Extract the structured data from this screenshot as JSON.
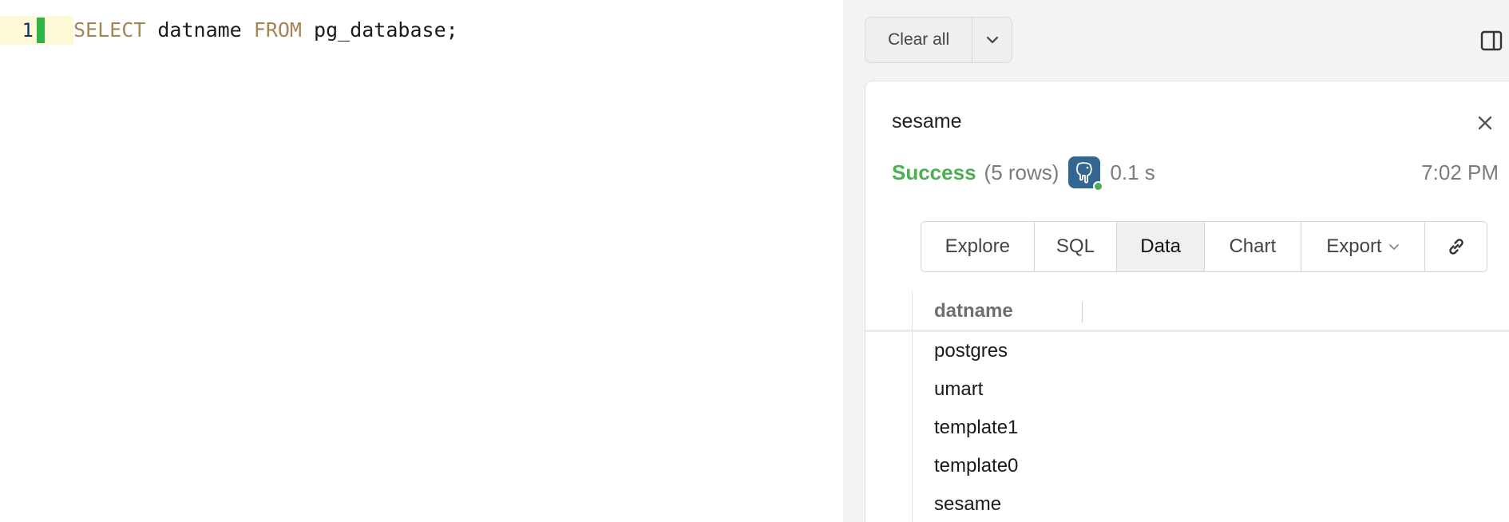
{
  "editor": {
    "line_number": "1",
    "code": {
      "kw_select": "SELECT",
      "column": " datname ",
      "kw_from": "FROM",
      "rest": " pg_database;"
    }
  },
  "toolbar": {
    "clear_all_label": "Clear all"
  },
  "result": {
    "title": "sesame",
    "status": "Success",
    "row_count": "(5 rows)",
    "duration": "0.1 s",
    "time": "7:02 PM",
    "tabs": {
      "explore": "Explore",
      "sql": "SQL",
      "data": "Data",
      "chart": "Chart",
      "export": "Export"
    },
    "active_tab": "Data",
    "table": {
      "column": "datname",
      "rows": [
        "postgres",
        "umart",
        "template1",
        "template0",
        "sesame"
      ]
    }
  },
  "icons": {
    "clear_menu": "chevron-down-icon",
    "panel_toggle": "sidebar-panel-icon",
    "close": "close-icon",
    "database": "postgresql-elephant-icon",
    "export_chevron": "chevron-down-icon",
    "link": "link-icon"
  },
  "colors": {
    "success": "#4caf50",
    "keyword": "#a38656",
    "cursor": "#2fb344",
    "postgres_badge": "#336791"
  }
}
